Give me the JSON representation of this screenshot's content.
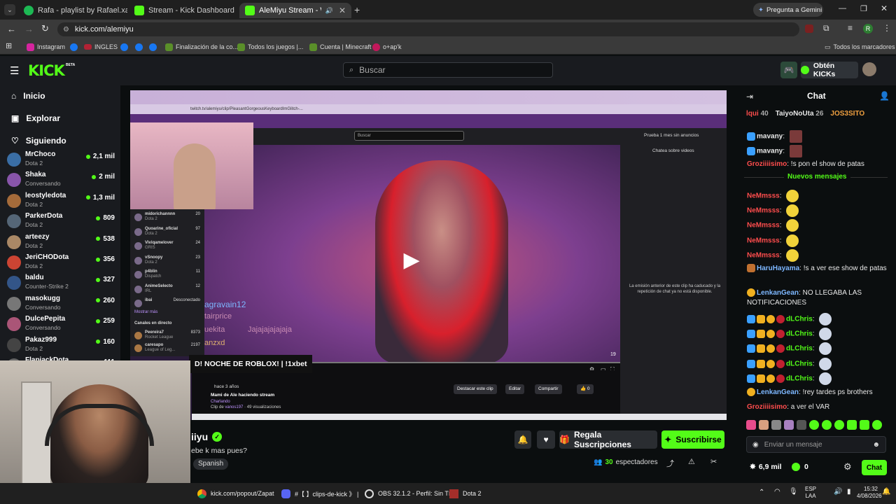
{
  "browser": {
    "tabs": [
      {
        "label": "Rafa - playlist by Rafael.xared |",
        "color": "#1db954"
      },
      {
        "label": "Stream - Kick Dashboard",
        "color": "#53fc18"
      },
      {
        "label": "AleMiyu Stream - Watch Live",
        "color": "#53fc18"
      }
    ],
    "gemini": "Pregunta a Gemini",
    "url": "kick.com/alemiyu",
    "bookmarks": [
      "Instagram",
      "INGLES",
      "Finalización de la co...",
      "Todos los juegos |...",
      "Cuenta | Minecraft",
      "o+ap'k"
    ],
    "all_bookmarks": "Todos los marcadores"
  },
  "header": {
    "logo": "KICK",
    "logo_tag": "BETA",
    "search_placeholder": "Buscar",
    "get_kicks": "Obtén KICKs"
  },
  "sidebar": {
    "nav": [
      {
        "label": "Inicio",
        "icon": "home-icon"
      },
      {
        "label": "Explorar",
        "icon": "compass-icon"
      },
      {
        "label": "Siguiendo",
        "icon": "heart-icon"
      }
    ],
    "channels": [
      {
        "name": "MrChoco",
        "game": "Dota 2",
        "viewers": "2,1 mil",
        "color": "#3a6ea5"
      },
      {
        "name": "Shaka",
        "game": "Conversando",
        "viewers": "2 mil",
        "color": "#8855aa"
      },
      {
        "name": "leostyledota",
        "game": "Dota 2",
        "viewers": "1,3 mil",
        "color": "#a56b3a"
      },
      {
        "name": "ParkerDota",
        "game": "Dota 2",
        "viewers": "809",
        "color": "#556677"
      },
      {
        "name": "arteezy",
        "game": "Dota 2",
        "viewers": "538",
        "color": "#aa8866"
      },
      {
        "name": "JeriCHODota",
        "game": "Dota 2",
        "viewers": "356",
        "color": "#cc4433"
      },
      {
        "name": "baldu",
        "game": "Counter-Strike 2",
        "viewers": "327",
        "color": "#335588"
      },
      {
        "name": "masokugg",
        "game": "Conversando",
        "viewers": "260",
        "color": "#777777"
      },
      {
        "name": "DulcePepita",
        "game": "Conversando",
        "viewers": "259",
        "color": "#aa5577"
      },
      {
        "name": "Pakaz999",
        "game": "Dota 2",
        "viewers": "160",
        "color": "#444444"
      },
      {
        "name": "FlapjackDota",
        "game": "",
        "viewers": "111",
        "color": "#666666"
      }
    ]
  },
  "video": {
    "inner_search": "Buscar",
    "inner_ad": "Prueba 1 mes sin anuncios",
    "inner_url": "twitch.tv/alemiyu/clip/PleasantGorgeousKeyboardImGlitch-...",
    "clip_chat_title": "Chatea sobre videos",
    "clip_notice": "La emisión anterior de este clip ha caducado y la repetición de chat ya no está disponible.",
    "clip_time": "hace 3 años",
    "clip_title": "Mami de Ale haciendo stream",
    "clip_cat": "Charlando",
    "clip_by": "Clip de",
    "clip_author": "vanos197",
    "clip_views": "49 visualizaciones",
    "btn_highlight": "Destacar este clip",
    "btn_edit": "Editar",
    "btn_share": "Compartir",
    "likes": "0",
    "overlay_title": "D! NOCHE DE ROBLOX! | !1xbet",
    "chat_names": [
      "agravain12",
      "tairprice",
      "uekita",
      "anzxd"
    ],
    "chat_line": "Jajajajajajaja",
    "twitch_channels": [
      {
        "name": "midorichannnn",
        "game": "Dota 2",
        "v": "20"
      },
      {
        "name": "Quoarine_oficial",
        "game": "Dota 2",
        "v": "97"
      },
      {
        "name": "Viviqamelover",
        "game": "GRIS",
        "v": "24"
      },
      {
        "name": "vSnoopy",
        "game": "Dota 2",
        "v": "23"
      },
      {
        "name": "p4blin",
        "game": "Dispatch",
        "v": "11"
      },
      {
        "name": "AnimeSelecto",
        "game": "IRL",
        "v": "12"
      },
      {
        "name": "ibai",
        "game": "",
        "v": "Desconectado"
      }
    ],
    "show_more": "Mostrar más",
    "live_label": "Canales en directo",
    "live_channels": [
      {
        "name": "Peereira7",
        "game": "Rocket League",
        "v": "8373"
      },
      {
        "name": "caresapo",
        "game": "League of Leg...",
        "v": "2197"
      }
    ],
    "timestamp": "19"
  },
  "stream_info": {
    "name_partial": "iiyu",
    "title_partial": "ebe k mas pues?",
    "language": "Spanish",
    "gift": "Regala Suscripciones",
    "subscribe": "Suscribirse",
    "viewers": "30",
    "viewers_label": "espectadores"
  },
  "chat": {
    "title": "Chat",
    "top_gifters": [
      {
        "name": "lqui",
        "count": "40"
      },
      {
        "name": "TaiyoNoUta",
        "count": "26"
      },
      {
        "name": "JOS3SITO",
        "count": ""
      }
    ],
    "new_messages": "Nuevos mensajes",
    "messages": [
      {
        "user": "mavany",
        "color": "#e8e8e8",
        "text": ""
      },
      {
        "user": "mavany",
        "color": "#e8e8e8",
        "text": ""
      },
      {
        "user": "Groziiiisimo",
        "color": "#ff4d4d",
        "text": "!s pon el show de patas"
      },
      {
        "user": "NeMmsss",
        "color": "#ff4d4d",
        "text": ""
      },
      {
        "user": "NeMmsss",
        "color": "#ff4d4d",
        "text": ""
      },
      {
        "user": "NeMmsss",
        "color": "#ff4d4d",
        "text": ""
      },
      {
        "user": "NeMmsss",
        "color": "#ff4d4d",
        "text": ""
      },
      {
        "user": "NeMmsss",
        "color": "#ff4d4d",
        "text": ""
      },
      {
        "user": "HaruHayama",
        "color": "#7db7ff",
        "text": "!s a ver ese show de patas"
      },
      {
        "user": "LenkanGean",
        "color": "#7db7ff",
        "text": "NO LLEGABA LAS NOTIFICACIONES"
      },
      {
        "user": "dLChris",
        "color": "#53fc18",
        "text": ""
      },
      {
        "user": "dLChris",
        "color": "#53fc18",
        "text": ""
      },
      {
        "user": "dLChris",
        "color": "#53fc18",
        "text": ""
      },
      {
        "user": "dLChris",
        "color": "#53fc18",
        "text": ""
      },
      {
        "user": "dLChris",
        "color": "#53fc18",
        "text": ""
      },
      {
        "user": "LenkanGean",
        "color": "#7db7ff",
        "text": "!rey tardes ps brothers"
      },
      {
        "user": "Groziiiisimo",
        "color": "#ff4d4d",
        "text": "a ver el VAR"
      }
    ],
    "input_placeholder": "Enviar un mensaje",
    "kicks": "6,9 mil",
    "points": "0",
    "send": "Chat"
  },
  "taskbar": {
    "items": [
      "kick.com/popout/Zapat",
      "#【 】clips-de-kick 》 |",
      "OBS 32.1.2 - Perfil: Sin Tí",
      "Dota 2"
    ],
    "lang": "ESP",
    "lang2": "LAA",
    "time": "15:32",
    "date": "4/08/2026"
  },
  "colors": {
    "accent": "#53fc18",
    "bg": "#0b0e0f",
    "panel": "#191b1f"
  }
}
